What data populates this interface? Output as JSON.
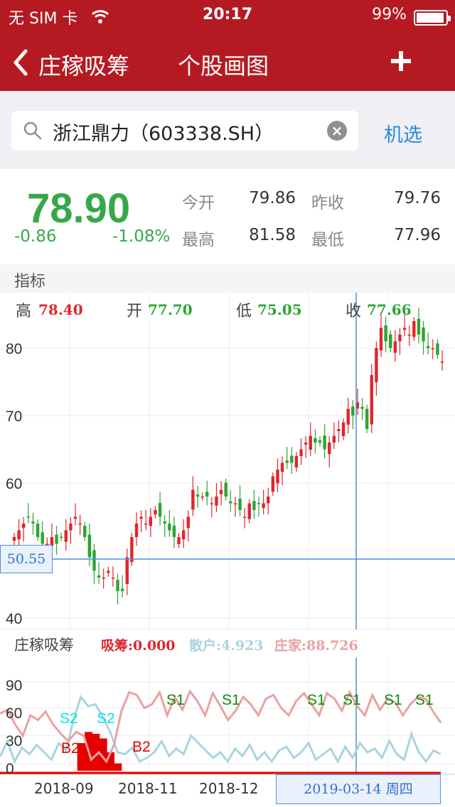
{
  "status": {
    "carrier": "无 SIM 卡",
    "time": "20:17",
    "battery": "99%"
  },
  "nav": {
    "back_label": "庄稼吸筹",
    "title": "个股画图"
  },
  "search": {
    "query": "浙江鼎力（603338.SH）",
    "select_label": "机选"
  },
  "quote": {
    "price": "78.90",
    "change": "-0.86",
    "change_pct": "-1.08%",
    "open_label": "今开",
    "open": "79.86",
    "prev_close_label": "昨收",
    "prev_close": "79.76",
    "high_label": "最高",
    "high": "81.58",
    "low_label": "最低",
    "low": "77.96"
  },
  "section": {
    "indicator": "指标"
  },
  "ohlc": {
    "high_label": "高",
    "high": "78.40",
    "open_label": "开",
    "open": "77.70",
    "low_label": "低",
    "low": "75.05",
    "close_label": "收",
    "close": "77.66"
  },
  "indicator": {
    "name": "庄稼吸筹",
    "absorb": "吸筹:0.000",
    "retail": "散户:4.923",
    "dealer": "庄家:88.726"
  },
  "crosshair": {
    "price": "50.55",
    "date": "2019-03-14 周四"
  },
  "colors": {
    "up": "#e0262c",
    "down": "#2ba532",
    "nav": "#b51a22",
    "accent": "#2a8ad8",
    "dealer_line": "#eaa1a1",
    "retail_line": "#a9d4e0"
  },
  "chart_data": [
    {
      "type": "candlestick",
      "ylim": [
        40,
        85
      ],
      "y_ticks": [
        "80",
        "70",
        "60",
        "40"
      ],
      "x_ticks": [
        "2018-09",
        "2018-11",
        "2018-12"
      ],
      "close_series": [
        52,
        53,
        54,
        55,
        54,
        52,
        51,
        51,
        52,
        51,
        52,
        53,
        54,
        55,
        54,
        52,
        49,
        47,
        46,
        46,
        47,
        46,
        44,
        44,
        49,
        52,
        54,
        55,
        54,
        55,
        56,
        55,
        54,
        53,
        52,
        52,
        53,
        55,
        59,
        58,
        58,
        58,
        57,
        58,
        59,
        58,
        57,
        57,
        56,
        55,
        57,
        56,
        57,
        57,
        58,
        61,
        62,
        63,
        63,
        63,
        64,
        65,
        66,
        67,
        66,
        66,
        65,
        66,
        67,
        68,
        69,
        71,
        70,
        72,
        71,
        68,
        76,
        80,
        83,
        81,
        80,
        81,
        82,
        83,
        82,
        84,
        82,
        81,
        80,
        80,
        79,
        78
      ]
    },
    {
      "type": "line",
      "ylim": [
        0,
        100
      ],
      "y_ticks": [
        "90",
        "60",
        "30",
        "0"
      ],
      "series": [
        {
          "name": "散户",
          "values": [
            15,
            32,
            10,
            25,
            18,
            28,
            20,
            12,
            30,
            22,
            55,
            80,
            70,
            72,
            58,
            42,
            20,
            18,
            25,
            10,
            14,
            20,
            32,
            16,
            24,
            18,
            38,
            30,
            22,
            14,
            20,
            10,
            24,
            16,
            28,
            12,
            20,
            10,
            22,
            26,
            14,
            20,
            30,
            12,
            18,
            24,
            10,
            26,
            14,
            30,
            20,
            24,
            14,
            32,
            18,
            12,
            40,
            20,
            10,
            22,
            18
          ]
        },
        {
          "name": "庄家",
          "values": [
            62,
            66,
            50,
            38,
            60,
            55,
            64,
            50,
            40,
            32,
            42,
            38,
            12,
            20,
            10,
            28,
            65,
            85,
            82,
            68,
            72,
            85,
            60,
            80,
            66,
            86,
            75,
            60,
            84,
            70,
            55,
            65,
            80,
            72,
            60,
            78,
            82,
            68,
            60,
            76,
            84,
            72,
            60,
            84,
            78,
            65,
            85,
            70,
            60,
            82,
            66,
            78,
            74,
            60,
            72,
            80,
            78,
            64,
            52
          ]
        },
        {
          "name": "吸筹",
          "values": [
            0,
            0,
            0,
            0,
            0,
            0,
            0,
            0,
            0,
            0,
            0,
            30,
            42,
            40,
            35,
            20,
            8,
            0,
            0,
            0,
            0,
            0,
            0,
            0,
            0,
            0,
            0,
            0,
            0,
            0,
            0,
            0,
            0,
            0,
            0,
            0,
            0,
            0,
            0,
            0,
            0,
            0,
            0,
            0,
            0,
            0,
            0,
            0,
            0,
            0,
            0,
            0,
            0,
            0,
            0,
            0,
            0,
            0,
            0,
            0,
            0
          ]
        }
      ],
      "signals": [
        "B2",
        "S2",
        "S2",
        "B2",
        "S1",
        "S1",
        "S1",
        "S1",
        "S1",
        "S1"
      ]
    }
  ]
}
